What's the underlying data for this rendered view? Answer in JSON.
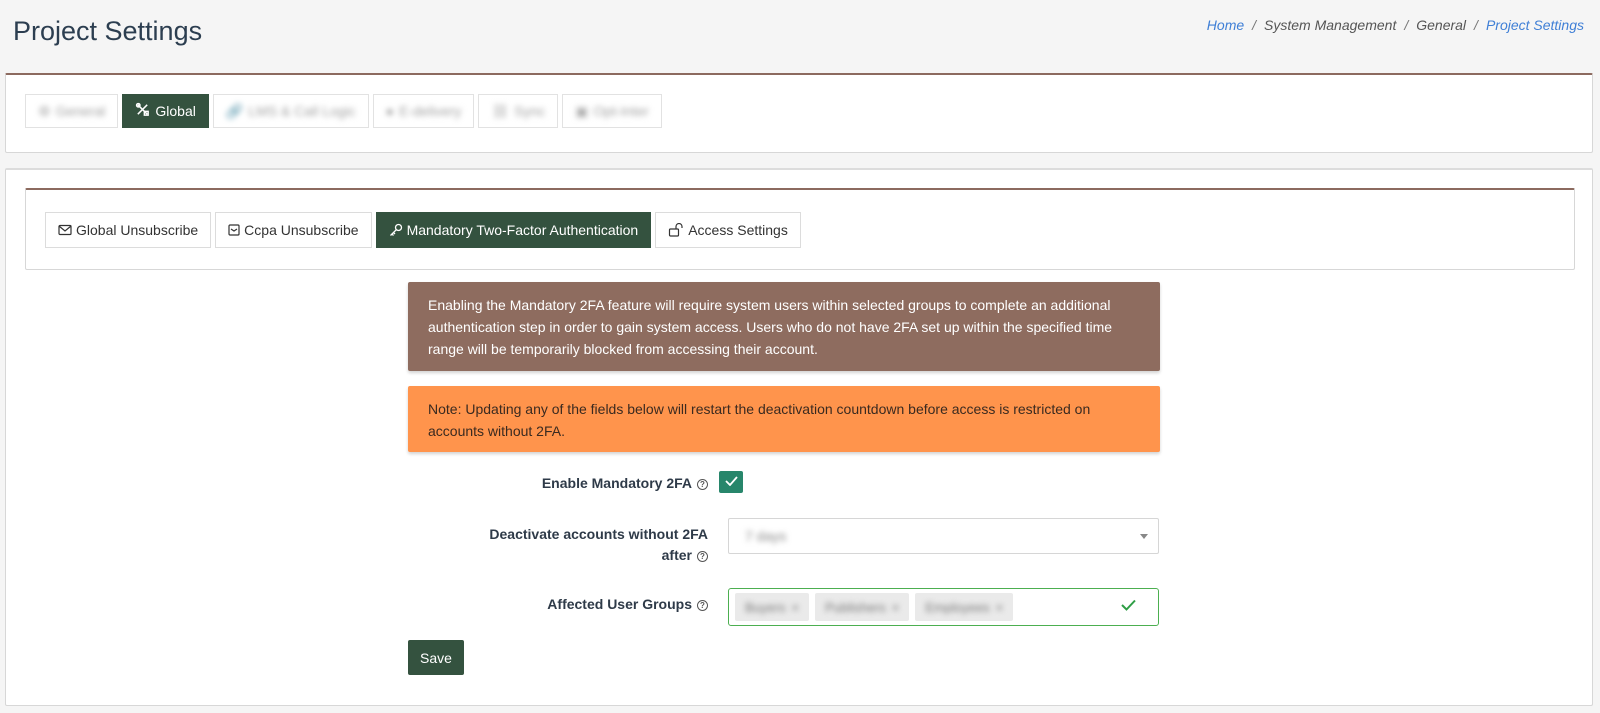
{
  "page": {
    "title": "Project Settings"
  },
  "breadcrumb": [
    "Home",
    "System Management",
    "General",
    "Project Settings"
  ],
  "top_tabs": [
    {
      "label": "General",
      "icon": "gear-icon",
      "active": false
    },
    {
      "label": "Global",
      "icon": "tools-icon",
      "active": true
    },
    {
      "label": "LMS & Call Logic",
      "icon": "link-icon",
      "active": false
    },
    {
      "label": "E-delivery",
      "icon": "globe-icon",
      "active": false
    },
    {
      "label": "Sync",
      "icon": "link-icon",
      "active": false
    },
    {
      "label": "Opt-Inter",
      "icon": "calendar-icon",
      "active": false
    }
  ],
  "sub_tabs": [
    {
      "label": "Global Unsubscribe",
      "icon": "envelope-icon",
      "active": false
    },
    {
      "label": "Ccpa Unsubscribe",
      "icon": "mail-box-icon",
      "active": false
    },
    {
      "label": "Mandatory Two-Factor Authentication",
      "icon": "key-icon",
      "active": true
    },
    {
      "label": "Access Settings",
      "icon": "unlock-icon",
      "active": false
    }
  ],
  "alerts": {
    "info": "Enabling the Mandatory 2FA feature will require system users within selected groups to complete an additional authentication step in order to gain system access. Users who do not have 2FA set up within the specified time range will be temporarily blocked from accessing their account.",
    "warning": "Note: Updating any of the fields below will restart the deactivation countdown before access is restricted on accounts without 2FA."
  },
  "form": {
    "enable_label": "Enable Mandatory 2FA",
    "enable_checked": true,
    "deactivate_label_line1": "Deactivate accounts without 2FA",
    "deactivate_label_line2": "after",
    "deactivate_value": "7 days",
    "groups_label": "Affected User Groups",
    "groups": [
      "Buyers",
      "Publishers",
      "Employees"
    ],
    "save_label": "Save"
  },
  "colors": {
    "primary": "#34523f",
    "info_bg": "#8e6c5f",
    "warning_bg": "#ff944c",
    "link": "#3f7fd6",
    "success": "#4caf50"
  }
}
